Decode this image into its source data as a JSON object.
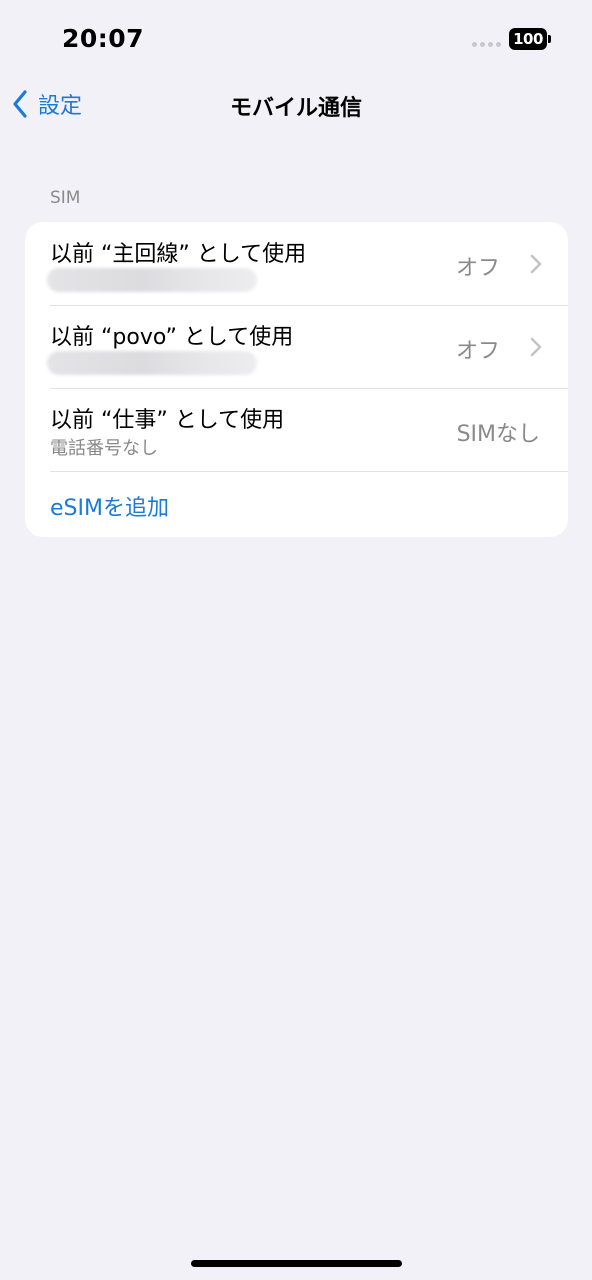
{
  "status_bar": {
    "time": "20:07",
    "battery": "100"
  },
  "nav": {
    "back_label": "設定",
    "title": "モバイル通信"
  },
  "sim_section": {
    "header": "SIM",
    "rows": [
      {
        "title": "以前 “主回線” として使用",
        "value": "オフ"
      },
      {
        "title": "以前 “povo” として使用",
        "value": "オフ"
      },
      {
        "title": "以前 “仕事” として使用",
        "subtitle": "電話番号なし",
        "value": "SIMなし"
      }
    ],
    "add_esim_label": "eSIMを追加"
  },
  "colors": {
    "accent": "#1a7ad9",
    "background": "#f2f1f7",
    "secondary_text": "#8a8a8e"
  }
}
